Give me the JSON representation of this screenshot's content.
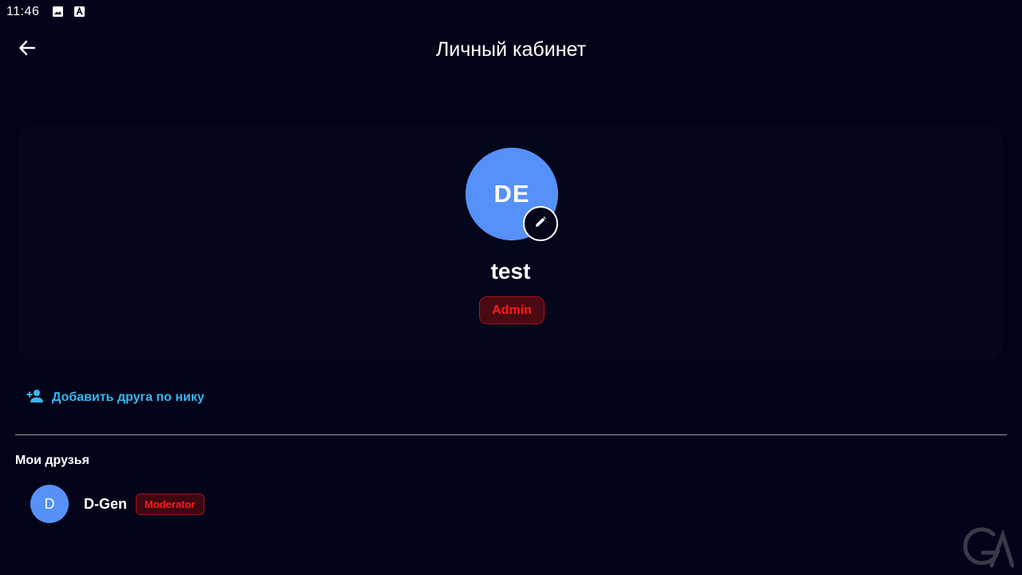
{
  "status_bar": {
    "time": "11:46",
    "icons": [
      "image-icon",
      "a-icon"
    ]
  },
  "app_bar": {
    "title": "Личный кабинет",
    "back_icon": "arrow-back-icon"
  },
  "profile": {
    "avatar_initials": "DE",
    "username": "test",
    "role": "Admin",
    "edit_icon": "pencil-icon"
  },
  "actions": {
    "add_friend_label": "Добавить друга по нику",
    "add_friend_icon": "person-add-icon"
  },
  "friends": {
    "heading": "Мои друзья",
    "items": [
      {
        "avatar_initial": "D",
        "name": "D-Gen",
        "role": "Moderator"
      }
    ]
  },
  "colors": {
    "background": "#03041a",
    "avatar": "#5591f8",
    "accent_link": "#38b7ee",
    "role_text": "#ff1a1a",
    "role_border": "#a8141e"
  }
}
